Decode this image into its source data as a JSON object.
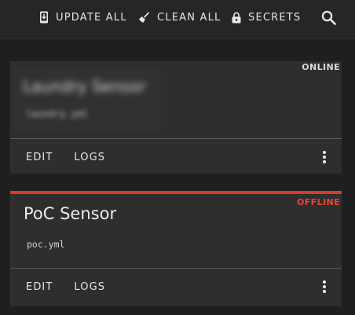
{
  "toolbar": {
    "update_all_label": "UPDATE ALL",
    "update_all_icon": "update-device-icon",
    "clean_all_label": "CLEAN ALL",
    "clean_all_icon": "broom-icon",
    "secrets_label": "SECRETS",
    "secrets_icon": "lock-icon",
    "search_icon": "search-icon"
  },
  "devices": [
    {
      "name": "Laundry Sensor",
      "file": "laundry.yml",
      "status": "ONLINE",
      "status_color": "#d8d8d8",
      "obscured": true,
      "actions": {
        "edit": "EDIT",
        "logs": "LOGS"
      }
    },
    {
      "name": "PoC Sensor",
      "file": "poc.yml",
      "status": "OFFLINE",
      "status_color": "#e0483a",
      "accent_color": "#d93a2b",
      "actions": {
        "edit": "EDIT",
        "logs": "LOGS"
      }
    }
  ],
  "colors": {
    "background": "#1f1f1f",
    "card": "#2e2e2e",
    "topbar": "#262626"
  }
}
